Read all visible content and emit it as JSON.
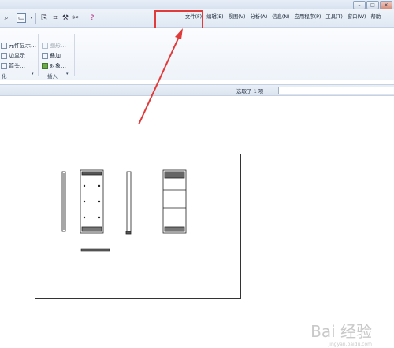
{
  "window": {
    "minimize": "–",
    "maximize": "□",
    "close": "✕"
  },
  "quick_access": {
    "icons": [
      "magnify-icon",
      "window-icon",
      "dropdown-icon",
      "tool-a-icon",
      "tool-b-icon",
      "tool-c-icon",
      "tool-d-icon",
      "help-icon"
    ]
  },
  "menu": {
    "items": [
      "文件(F)",
      "编辑(E)",
      "视图(V)",
      "分析(A)",
      "信息(N)",
      "应用程序(P)",
      "工具(T)",
      "窗口(W)",
      "帮助"
    ]
  },
  "ribbon": {
    "group1": {
      "items": [
        "元件显示…",
        "边显示…",
        "箭头…"
      ],
      "label": "化"
    },
    "group2": {
      "items": [
        "图形…",
        "叠加…",
        "对象…"
      ],
      "label": "插入"
    }
  },
  "status": {
    "selected_text": "选取了 1 项",
    "input_value": ""
  },
  "watermark": {
    "main": "Bai 经验",
    "sub": "jingyan.baidu.com"
  },
  "colors": {
    "highlight": "#e03a3a",
    "arrow": "#e03a3a"
  }
}
